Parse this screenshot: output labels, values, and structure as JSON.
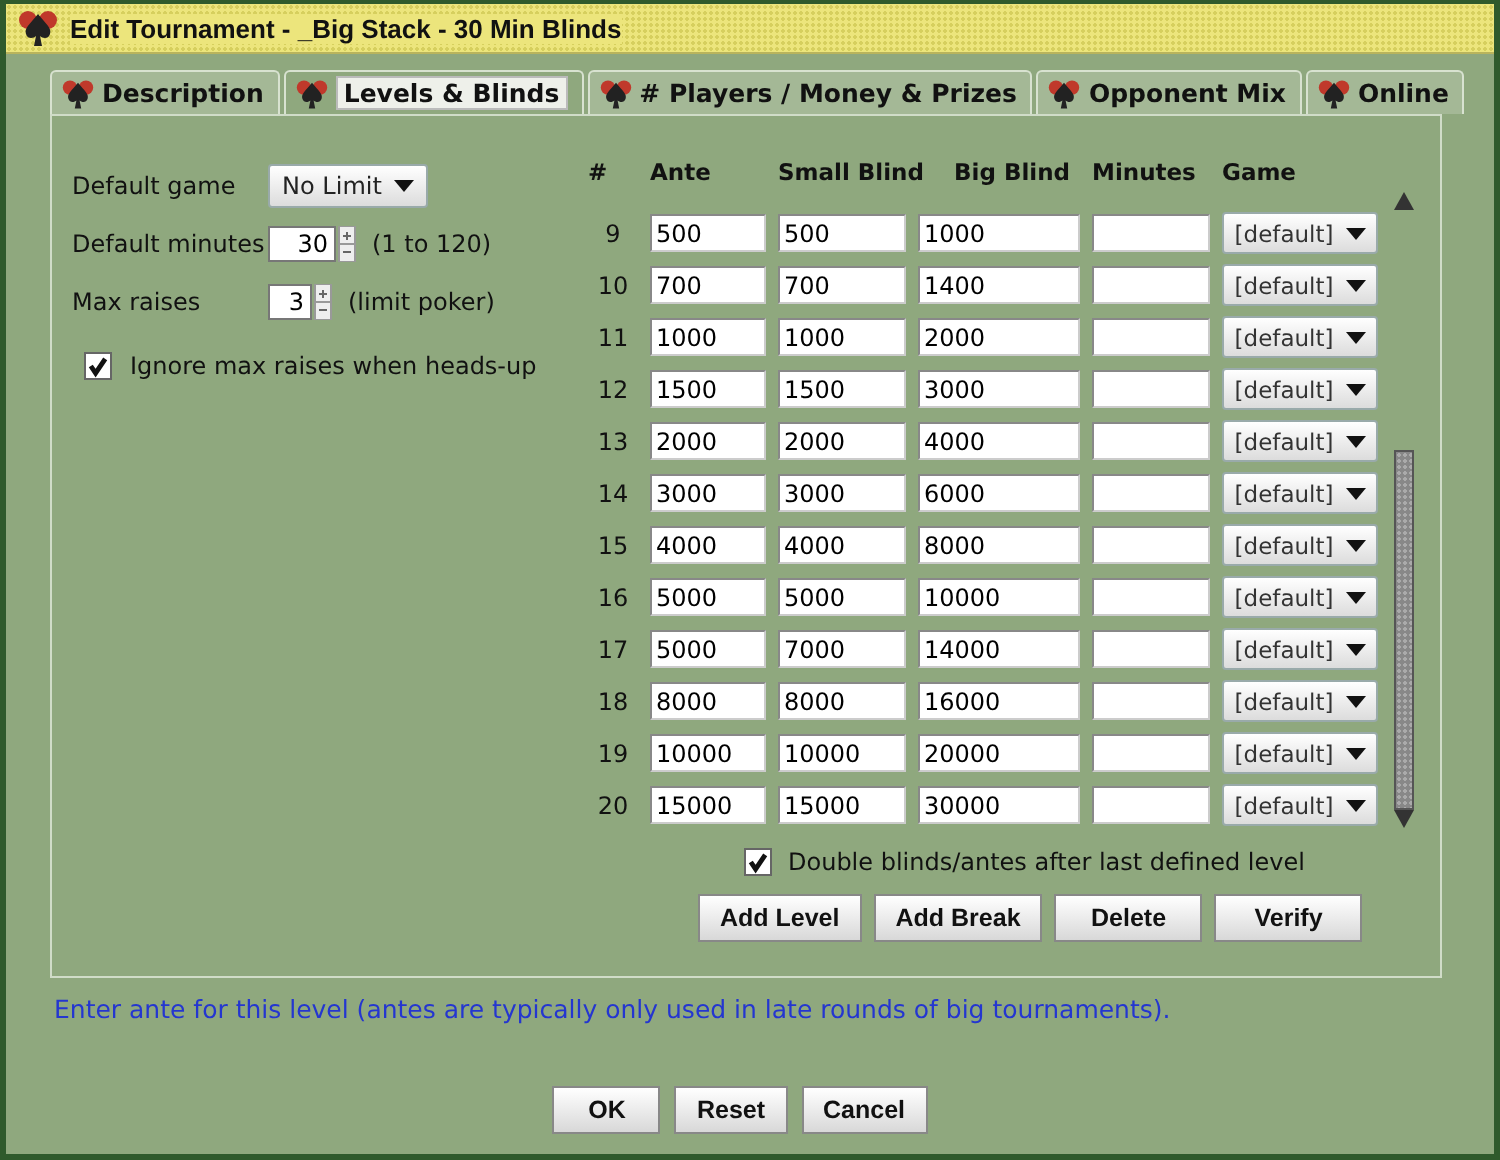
{
  "window": {
    "title": "Edit Tournament - _Big Stack - 30 Min Blinds"
  },
  "tabs": [
    {
      "label": "Description",
      "selected": false
    },
    {
      "label": "Levels & Blinds",
      "selected": true
    },
    {
      "label": "# Players / Money & Prizes",
      "selected": false
    },
    {
      "label": "Opponent Mix",
      "selected": false
    },
    {
      "label": "Online",
      "selected": false
    }
  ],
  "settings": {
    "default_game": {
      "label": "Default game",
      "value": "No Limit"
    },
    "default_minutes": {
      "label": "Default minutes",
      "value": "30",
      "hint": "(1 to 120)"
    },
    "max_raises": {
      "label": "Max raises",
      "value": "3",
      "hint": "(limit poker)"
    },
    "ignore_max_raises": {
      "label": "Ignore max raises when heads-up",
      "checked": true
    }
  },
  "table": {
    "columns": [
      "#",
      "Ante",
      "Small Blind",
      "Big Blind",
      "Minutes",
      "Game"
    ],
    "rows": [
      {
        "number": "9",
        "ante": "500",
        "small_blind": "500",
        "big_blind": "1000",
        "game": "[default]"
      },
      {
        "number": "10",
        "ante": "700",
        "small_blind": "700",
        "big_blind": "1400",
        "game": "[default]"
      },
      {
        "number": "11",
        "ante": "1000",
        "small_blind": "1000",
        "big_blind": "2000",
        "game": "[default]"
      },
      {
        "number": "12",
        "ante": "1500",
        "small_blind": "1500",
        "big_blind": "3000",
        "game": "[default]"
      },
      {
        "number": "13",
        "ante": "2000",
        "small_blind": "2000",
        "big_blind": "4000",
        "game": "[default]"
      },
      {
        "number": "14",
        "ante": "3000",
        "small_blind": "3000",
        "big_blind": "6000",
        "game": "[default]"
      },
      {
        "number": "15",
        "ante": "4000",
        "small_blind": "4000",
        "big_blind": "8000",
        "game": "[default]"
      },
      {
        "number": "16",
        "ante": "5000",
        "small_blind": "5000",
        "big_blind": "10000",
        "game": "[default]"
      },
      {
        "number": "17",
        "ante": "5000",
        "small_blind": "7000",
        "big_blind": "14000",
        "game": "[default]"
      },
      {
        "number": "18",
        "ante": "8000",
        "small_blind": "8000",
        "big_blind": "16000",
        "game": "[default]"
      },
      {
        "number": "19",
        "ante": "10000",
        "small_blind": "10000",
        "big_blind": "20000",
        "game": "[default]"
      },
      {
        "number": "20",
        "ante": "15000",
        "small_blind": "15000",
        "big_blind": "30000",
        "game": "[default]"
      }
    ]
  },
  "double_blinds": {
    "label": "Double blinds/antes after last defined level",
    "checked": true
  },
  "table_buttons": [
    "Add Level",
    "Add Break",
    "Delete",
    "Verify"
  ],
  "hint": "Enter ante for this level (antes are typically only used in late rounds of big tournaments).",
  "buttons": [
    "OK",
    "Reset",
    "Cancel"
  ]
}
